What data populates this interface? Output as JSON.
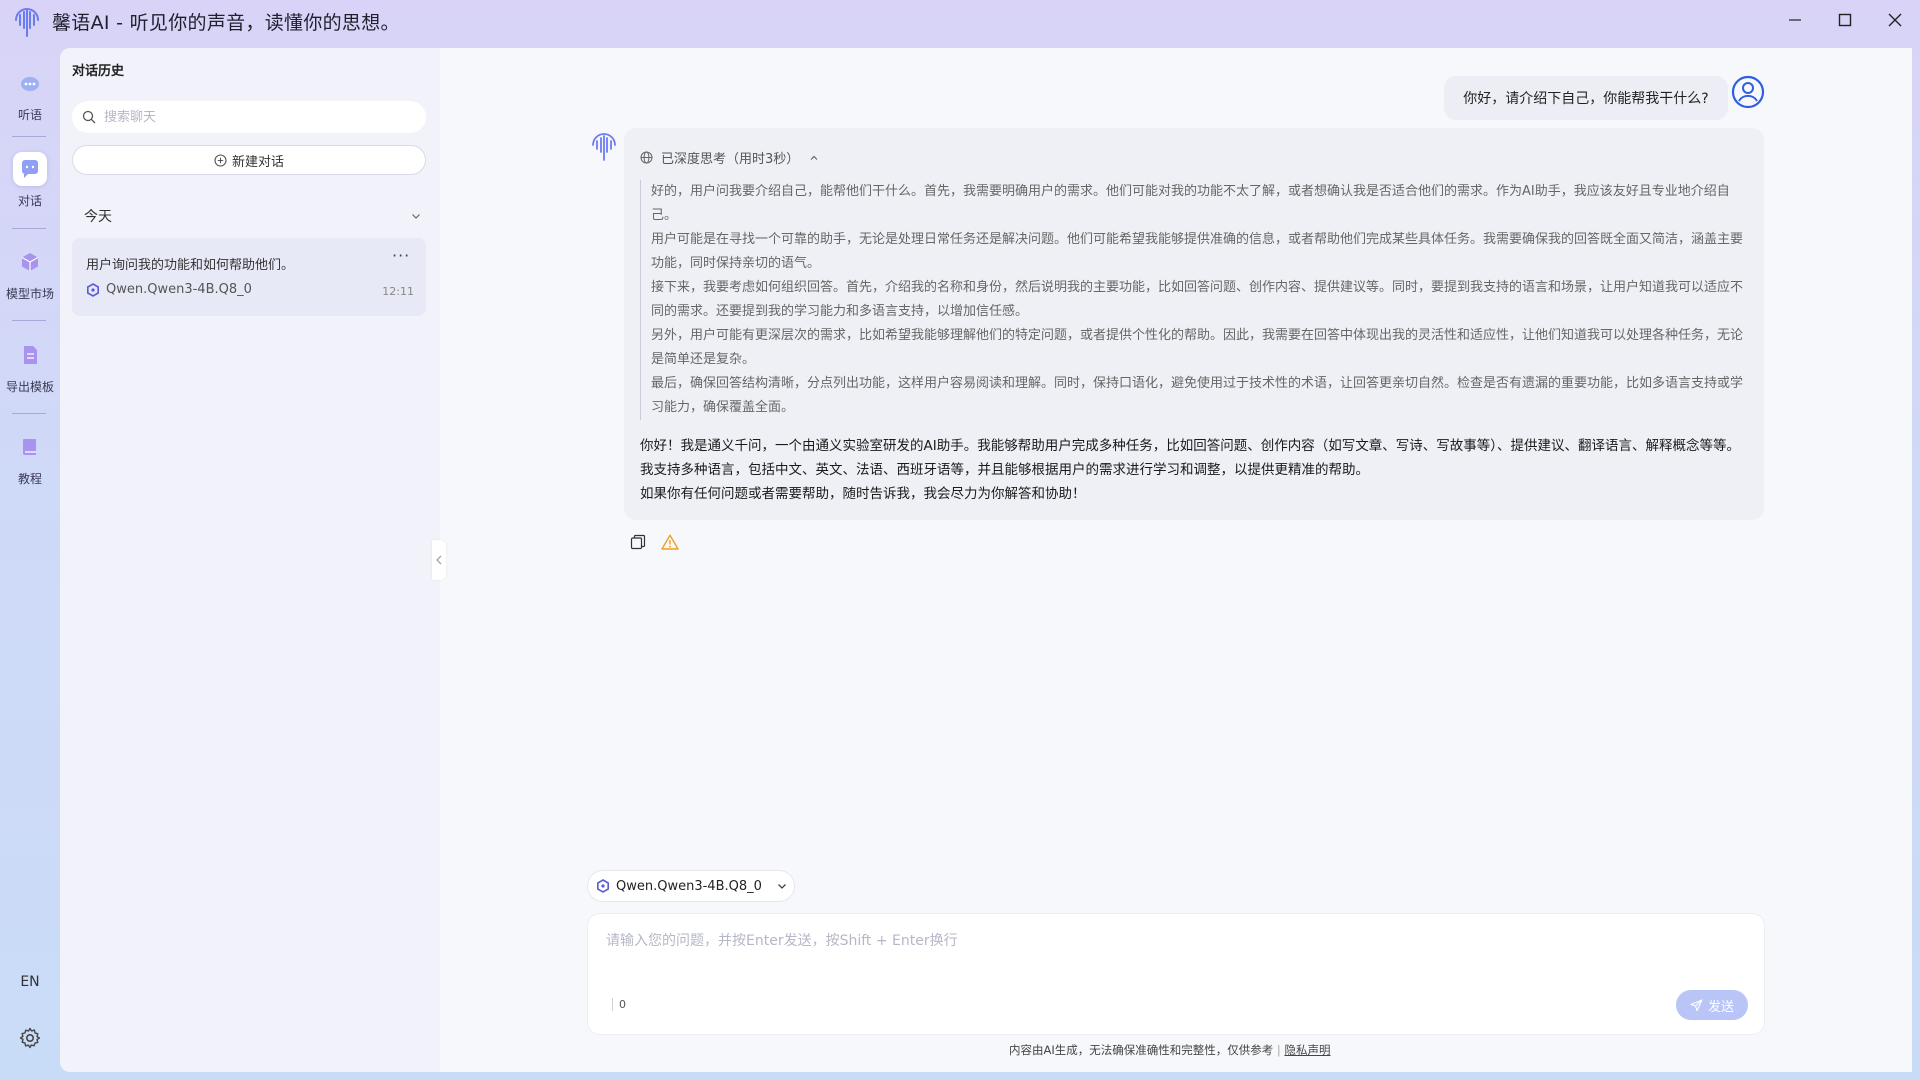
{
  "window": {
    "title": "馨语AI - 听见你的声音，读懂你的思想。"
  },
  "rail": {
    "items": [
      {
        "label": "听语",
        "icon": "ear-icon"
      },
      {
        "label": "对话",
        "icon": "chat-bubble-icon"
      },
      {
        "label": "模型市场",
        "icon": "cube-icon"
      },
      {
        "label": "导出模板",
        "icon": "document-icon"
      },
      {
        "label": "教程",
        "icon": "book-icon"
      }
    ],
    "language": "EN",
    "settings_icon": "gear-icon"
  },
  "history": {
    "title": "对话历史",
    "search_placeholder": "搜索聊天",
    "new_chat_label": "新建对话",
    "group_label": "今天",
    "conversations": [
      {
        "title": "用户询问我的功能和如何帮助他们。",
        "model": "Qwen.Qwen3-4B.Q8_0",
        "time": "12:11"
      }
    ]
  },
  "chat": {
    "user_message": "你好，请介绍下自己，你能帮我干什么?",
    "thinking_label": "已深度思考（用时3秒）",
    "thinking_lines": [
      "好的，用户问我要介绍自己，能帮他们干什么。首先，我需要明确用户的需求。他们可能对我的功能不太了解，或者想确认我是否适合他们的需求。作为AI助手，我应该友好且专业地介绍自己。",
      "用户可能是在寻找一个可靠的助手，无论是处理日常任务还是解决问题。他们可能希望我能够提供准确的信息，或者帮助他们完成某些具体任务。我需要确保我的回答既全面又简洁，涵盖主要功能，同时保持亲切的语气。",
      "接下来，我要考虑如何组织回答。首先，介绍我的名称和身份，然后说明我的主要功能，比如回答问题、创作内容、提供建议等。同时，要提到我支持的语言和场景，让用户知道我可以适应不同的需求。还要提到我的学习能力和多语言支持，以增加信任感。",
      "另外，用户可能有更深层次的需求，比如希望我能够理解他们的特定问题，或者提供个性化的帮助。因此，我需要在回答中体现出我的灵活性和适应性，让他们知道我可以处理各种任务，无论是简单还是复杂。",
      "最后，确保回答结构清晰，分点列出功能，这样用户容易阅读和理解。同时，保持口语化，避免使用过于技术性的术语，让回答更亲切自然。检查是否有遗漏的重要功能，比如多语言支持或学习能力，确保覆盖全面。"
    ],
    "answer_lines": [
      "你好！我是通义千问，一个由通义实验室研发的AI助手。我能够帮助用户完成多种任务，比如回答问题、创作内容（如写文章、写诗、写故事等）、提供建议、翻译语言、解释概念等等。我支持多种语言，包括中文、英文、法语、西班牙语等，并且能够根据用户的需求进行学习和调整，以提供更精准的帮助。",
      "如果你有任何问题或者需要帮助，随时告诉我，我会尽力为你解答和协助！"
    ]
  },
  "composer": {
    "model": "Qwen.Qwen3-4B.Q8_0",
    "placeholder": "请输入您的问题，并按Enter发送，按Shift + Enter换行",
    "char_count": "0",
    "send_label": "发送",
    "disclaimer": "内容由AI生成，无法确保准确性和完整性，仅供参考",
    "privacy_link": "隐私声明"
  },
  "colors": {
    "accent": "#6b7cf0",
    "send_disabled": "#b8c5f6",
    "warning": "#f0a020"
  }
}
